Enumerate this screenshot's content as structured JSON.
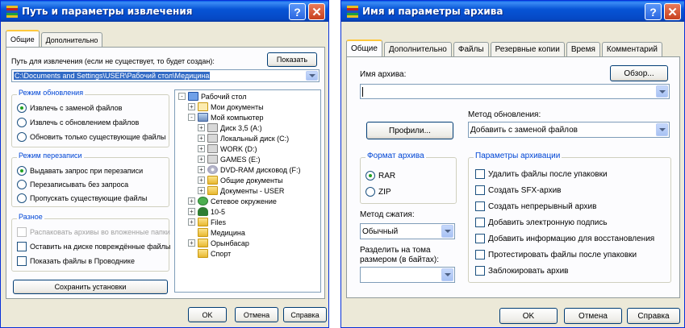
{
  "left": {
    "title": "Путь и параметры извлечения",
    "tabs": [
      "Общие",
      "Дополнительно"
    ],
    "path_label": "Путь для извлечения (если не существует, то будет создан):",
    "show_button": "Показать",
    "path_value": "C:\\Documents and Settings\\USER\\Рабочий стол\\Медицина",
    "update_group": {
      "title": "Режим обновления",
      "options": [
        "Извлечь с заменой файлов",
        "Извлечь с обновлением файлов",
        "Обновить только существующие файлы"
      ],
      "selected": 0
    },
    "overwrite_group": {
      "title": "Режим перезаписи",
      "options": [
        "Выдавать запрос при перезаписи",
        "Перезаписывать без запроса",
        "Пропускать существующие файлы"
      ],
      "selected": 0
    },
    "misc_group": {
      "title": "Разное",
      "options": [
        "Распаковать архивы во вложенные папки",
        "Оставить на диске повреждённые файлы",
        "Показать файлы в Проводнике"
      ],
      "disabled": [
        true,
        false,
        false
      ]
    },
    "save_button": "Сохранить установки",
    "tree": [
      {
        "label": "Рабочий стол",
        "icon": "desktop-icon",
        "pm": "-"
      },
      {
        "label": "Мои документы",
        "icon": "documents-folder-icon",
        "pm": "+"
      },
      {
        "label": "Мой компьютер",
        "icon": "computer-icon",
        "pm": "-"
      },
      {
        "label": "Диск 3,5 (A:)",
        "icon": "floppy-icon",
        "pm": "+"
      },
      {
        "label": "Локальный диск (C:)",
        "icon": "drive-icon",
        "pm": "+"
      },
      {
        "label": "WORK (D:)",
        "icon": "drive-icon",
        "pm": "+"
      },
      {
        "label": "GAMES (E:)",
        "icon": "drive-icon",
        "pm": "+"
      },
      {
        "label": "DVD-RAM дисковод (F:)",
        "icon": "dvd-icon",
        "pm": "+"
      },
      {
        "label": "Общие документы",
        "icon": "folder-icon",
        "pm": "+"
      },
      {
        "label": "Документы - USER",
        "icon": "folder-icon",
        "pm": "+"
      },
      {
        "label": "Сетевое окружение",
        "icon": "network-icon",
        "pm": "+"
      },
      {
        "label": "10-5",
        "icon": "tree-icon",
        "pm": "+"
      },
      {
        "label": "Files",
        "icon": "folder-icon",
        "pm": "+"
      },
      {
        "label": "Медицина",
        "icon": "folder-icon",
        "pm": ""
      },
      {
        "label": "Орынбасар",
        "icon": "folder-icon",
        "pm": "+"
      },
      {
        "label": "Спорт",
        "icon": "folder-icon",
        "pm": ""
      }
    ],
    "buttons": {
      "ok": "OK",
      "cancel": "Отмена",
      "help": "Справка"
    }
  },
  "right": {
    "title": "Имя и параметры архива",
    "tabs": [
      "Общие",
      "Дополнительно",
      "Файлы",
      "Резервные копии",
      "Время",
      "Комментарий"
    ],
    "archive_name_label": "Имя архива:",
    "browse_button": "Обзор...",
    "archive_name_value": "",
    "update_method_label": "Метод обновления:",
    "update_method_value": "Добавить с заменой файлов",
    "profiles_button": "Профили...",
    "format_group": {
      "title": "Формат архива",
      "options": [
        "RAR",
        "ZIP"
      ],
      "selected": 0
    },
    "compression_label": "Метод сжатия:",
    "compression_value": "Обычный",
    "split_label_1": "Разделить на тома",
    "split_label_2": "размером (в байтах):",
    "split_value": "",
    "params_group": {
      "title": "Параметры архивации",
      "options": [
        "Удалить файлы после упаковки",
        "Создать SFX-архив",
        "Создать непрерывный архив",
        "Добавить электронную подпись",
        "Добавить информацию для восстановления",
        "Протестировать файлы после упаковки",
        "Заблокировать архив"
      ]
    },
    "buttons": {
      "ok": "OK",
      "cancel": "Отмена",
      "help": "Справка"
    }
  }
}
